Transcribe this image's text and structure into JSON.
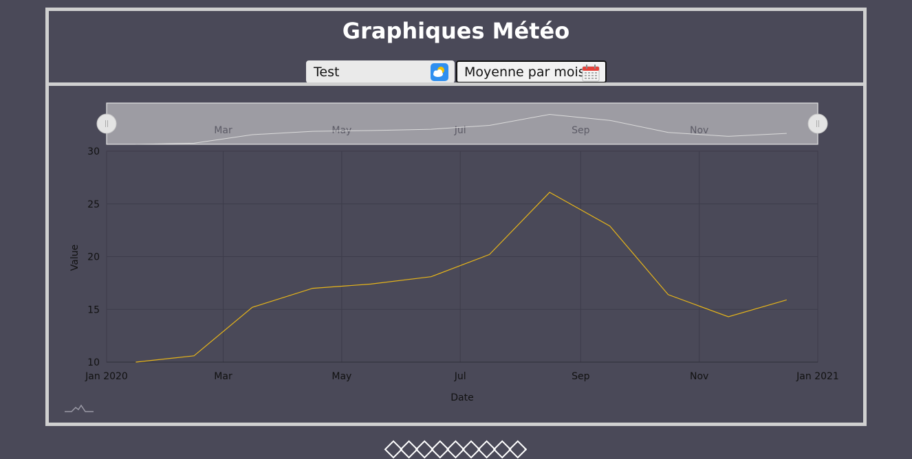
{
  "header": {
    "title": "Graphiques Météo"
  },
  "selectors": {
    "station": {
      "value": "Test",
      "icon": "weather-cloud-sun-icon"
    },
    "aggregation": {
      "value": "Moyenne par mois",
      "icon": "calendar-icon"
    }
  },
  "colors": {
    "background": "#4a4958",
    "border": "#d0d0d0",
    "series": "#e8b619",
    "navigator_fill": "#9d9ca3"
  },
  "chart_data": {
    "type": "line",
    "xlabel": "Date",
    "ylabel": "Value",
    "x_ticks": [
      "Jan 2020",
      "Mar",
      "May",
      "Jul",
      "Sep",
      "Nov",
      "Jan 2021"
    ],
    "x_tick_dates": [
      "2020-01-01",
      "2020-03-01",
      "2020-05-01",
      "2020-07-01",
      "2020-09-01",
      "2020-11-01",
      "2021-01-01"
    ],
    "navigator_ticks": [
      "Mar",
      "May",
      "Jul",
      "Sep",
      "Nov"
    ],
    "navigator_tick_dates": [
      "2020-03-01",
      "2020-05-01",
      "2020-07-01",
      "2020-09-01",
      "2020-11-01"
    ],
    "y_ticks": [
      10,
      15,
      20,
      25,
      30
    ],
    "ylim": [
      10,
      30
    ],
    "xlim": [
      "2020-01-01",
      "2021-01-01"
    ],
    "grid": true,
    "series": [
      {
        "x": [
          "2020-01-16",
          "2020-02-15",
          "2020-03-16",
          "2020-04-16",
          "2020-05-16",
          "2020-06-16",
          "2020-07-16",
          "2020-08-16",
          "2020-09-16",
          "2020-10-16",
          "2020-11-16",
          "2020-12-16"
        ],
        "values": [
          10.0,
          10.6,
          15.2,
          17.0,
          17.4,
          18.1,
          20.2,
          26.1,
          22.9,
          16.4,
          14.3,
          15.9
        ]
      }
    ]
  }
}
